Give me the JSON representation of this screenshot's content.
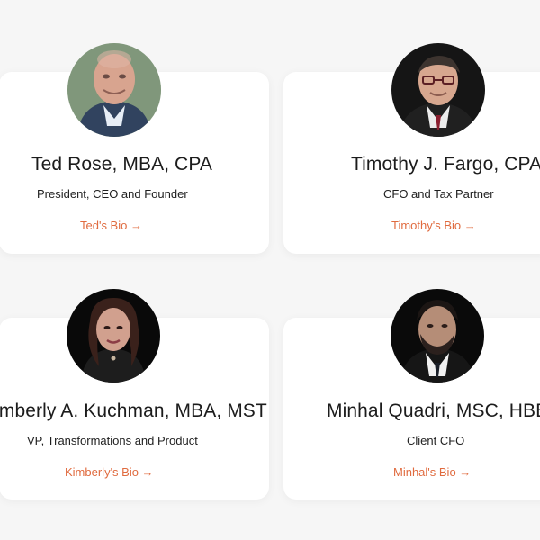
{
  "team": [
    {
      "name": "Ted Rose, MBA, CPA",
      "role": "President, CEO and Founder",
      "bio_link": "Ted's Bio →",
      "avatar_colors": {
        "bg": "#8fa78c",
        "skin": "#d8a48f",
        "jacket": "#31435f",
        "shirt": "#e7eef7"
      }
    },
    {
      "name": "Timothy J. Fargo, CPA",
      "role": "CFO and Tax Partner",
      "bio_link": "Timothy's Bio →",
      "avatar_colors": {
        "bg": "#151515",
        "skin": "#d7a78f",
        "jacket": "#202020",
        "shirt": "#ececec",
        "tie": "#8a1e2f"
      }
    },
    {
      "name": "Kimberly A. Kuchman, MBA, MST",
      "role": "VP, Transformations and Product",
      "bio_link": "Kimberly's Bio →",
      "avatar_colors": {
        "bg": "#090909",
        "skin": "#d1a08e",
        "hair": "#3a211b",
        "dress": "#1d1d1d"
      }
    },
    {
      "name": "Minhal Quadri, MSC, HBBA",
      "role": "Client CFO",
      "bio_link": "Minhal's Bio →",
      "avatar_colors": {
        "bg": "#0a0a0a",
        "skin": "#b58d77",
        "hair": "#1c1614",
        "jacket": "#161616",
        "shirt": "#f1f1f1"
      }
    }
  ],
  "theme": {
    "page_bg": "#f6f6f6",
    "card_bg": "#ffffff",
    "text": "#1c1c1c",
    "accent": "#e06b3f"
  }
}
